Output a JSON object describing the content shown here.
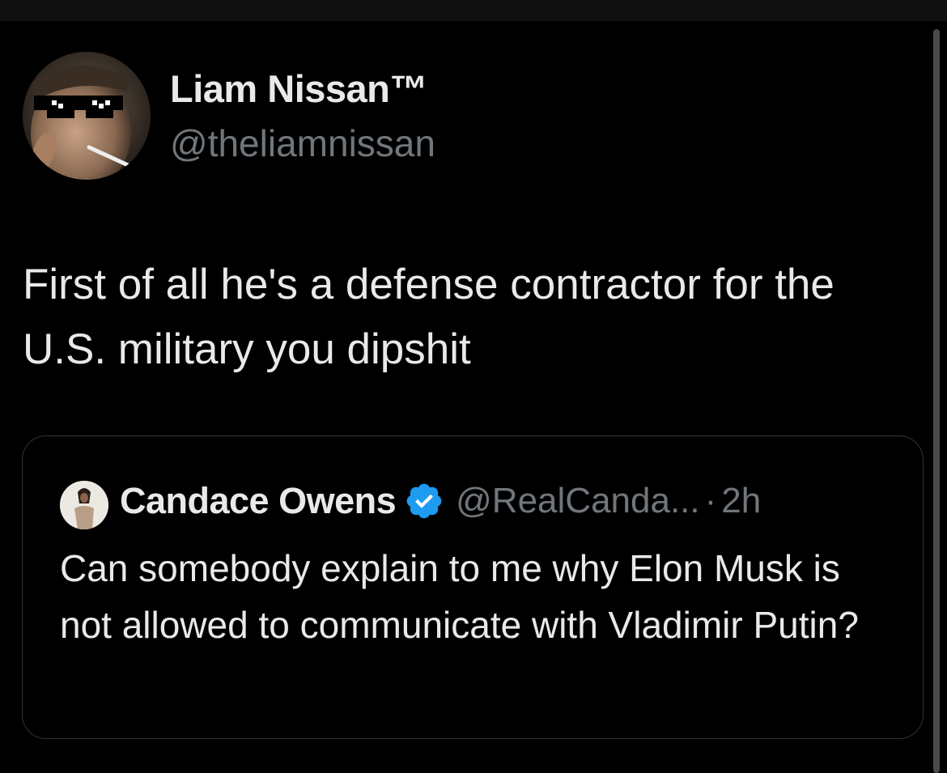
{
  "tweet": {
    "author": {
      "display_name": "Liam Nissan™",
      "handle": "@theliamnissan",
      "avatar": "avatar-photo"
    },
    "text": "First of all he's a defense contractor for the U.S. military you dipshit"
  },
  "quoted_tweet": {
    "author": {
      "display_name": "Candace Owens",
      "handle": "@RealCanda...",
      "verified": true,
      "avatar": "avatar-photo"
    },
    "separator": "·",
    "time": "2h",
    "text": "Can somebody explain to me why Elon Musk is not allowed to communicate with Vladimir Putin?"
  },
  "colors": {
    "background": "#000000",
    "primary_text": "#e7e9ea",
    "secondary_text": "#71767b",
    "border": "#2f3336",
    "verified_badge": "#1d9bf0"
  },
  "icons": {
    "verified": "verified-badge-icon"
  }
}
